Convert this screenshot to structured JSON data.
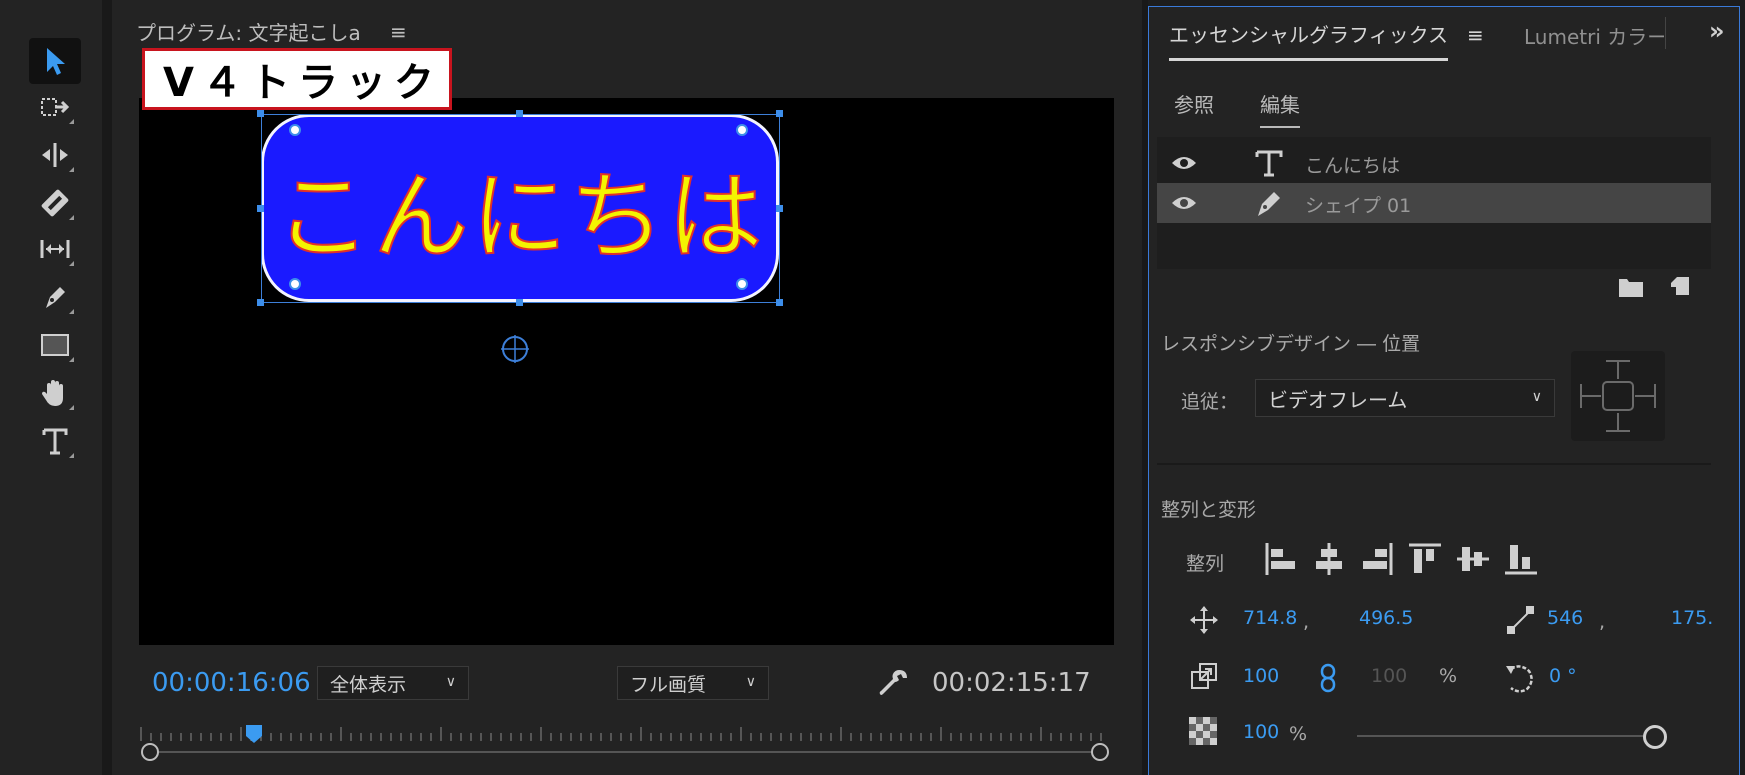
{
  "monitor": {
    "title": "プログラム: 文字起こしa",
    "menu_glyph": "≡",
    "track_label": "V４トラック",
    "shape_text": "こんにちは",
    "current_timecode": "00:00:16:06",
    "duration_timecode": "00:02:15:17",
    "zoom_select": "全体表示",
    "quality_select": "フル画質"
  },
  "panel": {
    "tab_active": "エッセンシャルグラフィックス",
    "menu_glyph": "≡",
    "tab_other": "Lumetri カラー",
    "more_glyph": "»",
    "subtabs": [
      "参照",
      "編集"
    ],
    "layers": [
      {
        "name": "こんにちは",
        "type": "text"
      },
      {
        "name": "シェイプ 01",
        "type": "shape"
      }
    ],
    "responsive_title": "レスポンシブデザイン ― 位置",
    "follow_label": "追従：",
    "follow_value": "ビデオフレーム",
    "align_title": "整列と変形",
    "align_label": "整列",
    "position_x": "714.8",
    "position_sep": ",",
    "position_y": "496.5",
    "anchor_x": "546",
    "anchor_sep": ",",
    "anchor_y": "175.",
    "scale": "100",
    "scale_w": "100",
    "scale_unit": "%",
    "rotation": "0 °",
    "opacity": "100",
    "opacity_unit": "%",
    "opacity_slider": 1.0
  },
  "colors": {
    "accent": "#3b9bf1",
    "shape_fill": "#1a1aff",
    "shape_text": "#f4f400",
    "shape_text_stroke": "#e2302a",
    "track_label_border": "#c8141e"
  }
}
